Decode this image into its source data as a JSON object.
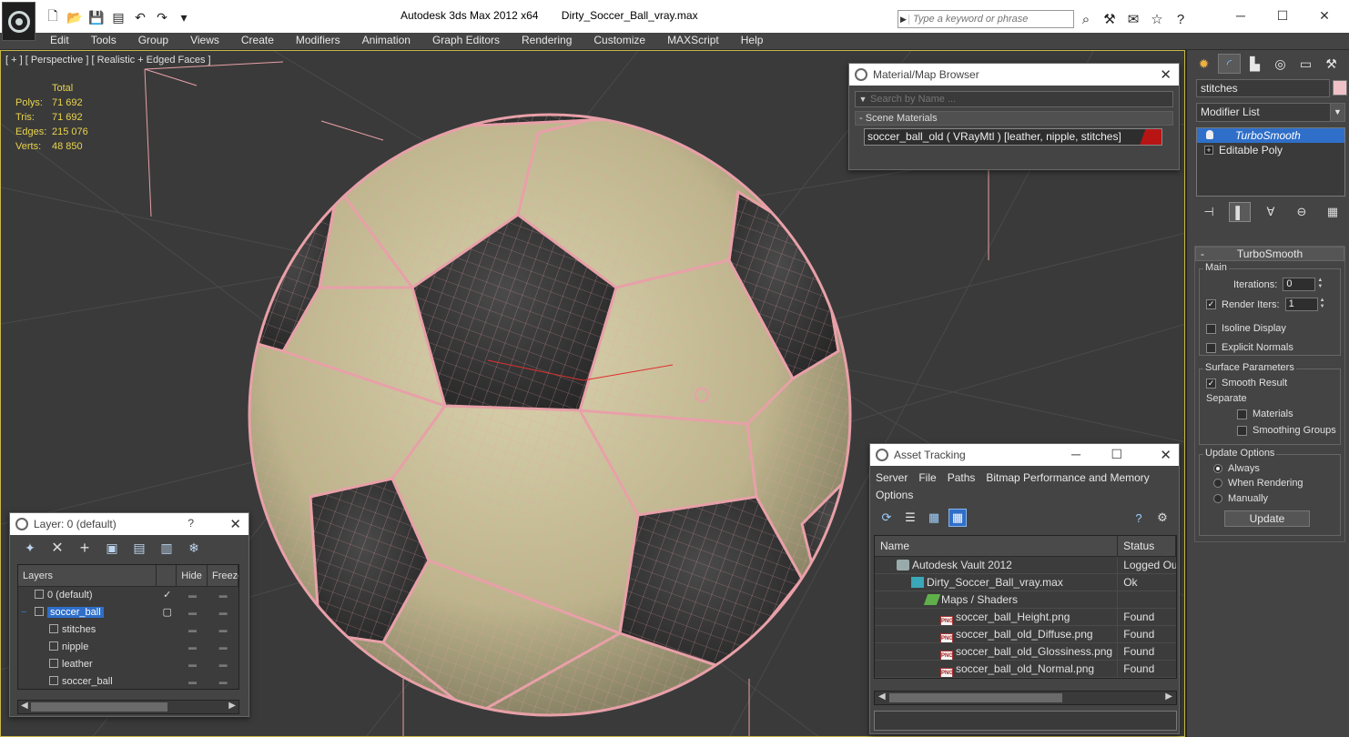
{
  "titlebar": {
    "app_name": "Autodesk 3ds Max  2012 x64",
    "file_name": "Dirty_Soccer_Ball_vray.max",
    "search_placeholder": "Type a keyword or phrase"
  },
  "menu": [
    "Edit",
    "Tools",
    "Group",
    "Views",
    "Create",
    "Modifiers",
    "Animation",
    "Graph Editors",
    "Rendering",
    "Customize",
    "MAXScript",
    "Help"
  ],
  "viewport": {
    "label": "[ + ] [ Perspective ] [ Realistic + Edged Faces ]",
    "stats": {
      "header": "Total",
      "rows": [
        {
          "k": "Polys:",
          "v": "71 692"
        },
        {
          "k": "Tris:",
          "v": "71 692"
        },
        {
          "k": "Edges:",
          "v": "215 076"
        },
        {
          "k": "Verts:",
          "v": "48 850"
        }
      ]
    },
    "ball_colors": {
      "leather": "#c8c19a",
      "dark": "#3a3a3a",
      "wire": "#e8a0a8"
    }
  },
  "material_browser": {
    "title": "Material/Map Browser",
    "search_placeholder": "Search by Name ...",
    "group": "- Scene Materials",
    "entry": "soccer_ball_old  ( VRayMtl )  [leather, nipple, stitches]"
  },
  "layer_window": {
    "title": "Layer: 0 (default)",
    "help": "?",
    "columns": [
      "Layers",
      "Hide",
      "Freeze"
    ],
    "rows": [
      {
        "name": "0 (default)",
        "check": "✓",
        "indent": 1
      },
      {
        "name": "soccer_ball",
        "check": "▢",
        "indent": 1,
        "selected": true,
        "expand": "−"
      },
      {
        "name": "stitches",
        "check": "",
        "indent": 2
      },
      {
        "name": "nipple",
        "check": "",
        "indent": 2
      },
      {
        "name": "leather",
        "check": "",
        "indent": 2
      },
      {
        "name": "soccer_ball",
        "check": "",
        "indent": 2
      }
    ],
    "dash": "▬"
  },
  "asset_tracking": {
    "title": "Asset Tracking",
    "menu": [
      "Server",
      "File",
      "Paths",
      "Bitmap Performance and Memory",
      "Options"
    ],
    "columns": [
      "Name",
      "Status"
    ],
    "rows": [
      {
        "name": "Autodesk Vault 2012",
        "status": "Logged Out",
        "icon": "vault",
        "indent": 24
      },
      {
        "name": "Dirty_Soccer_Ball_vray.max",
        "status": "Ok",
        "icon": "max",
        "indent": 40
      },
      {
        "name": "Maps / Shaders",
        "status": "",
        "icon": "maps",
        "indent": 56
      },
      {
        "name": "soccer_ball_Height.png",
        "status": "Found",
        "icon": "png",
        "indent": 72
      },
      {
        "name": "soccer_ball_old_Diffuse.png",
        "status": "Found",
        "icon": "png",
        "indent": 72
      },
      {
        "name": "soccer_ball_old_Glossiness.png",
        "status": "Found",
        "icon": "png",
        "indent": 72
      },
      {
        "name": "soccer_ball_old_Normal.png",
        "status": "Found",
        "icon": "png",
        "indent": 72
      }
    ],
    "png_label": "PNG"
  },
  "command_panel": {
    "object_name": "stitches",
    "object_color": "#f0c2c8",
    "modifier_list": "Modifier List",
    "stack": [
      {
        "name": "TurboSmooth",
        "selected": true
      },
      {
        "name": "Editable Poly",
        "selected": false
      }
    ],
    "rollout_title": "TurboSmooth",
    "rollout_toggle": "-",
    "main": {
      "label": "Main",
      "iterations_label": "Iterations:",
      "iterations_value": "0",
      "render_iters_label": "Render Iters:",
      "render_iters_value": "1",
      "render_iters_checked": true,
      "isoline_label": "Isoline Display",
      "explicit_normals_label": "Explicit Normals"
    },
    "surface": {
      "label": "Surface Parameters",
      "smooth_result_label": "Smooth Result",
      "separate_label": "Separate",
      "materials_label": "Materials",
      "smoothing_groups_label": "Smoothing Groups"
    },
    "update": {
      "label": "Update Options",
      "always": "Always",
      "when_rendering": "When Rendering",
      "manually": "Manually",
      "button": "Update"
    }
  }
}
